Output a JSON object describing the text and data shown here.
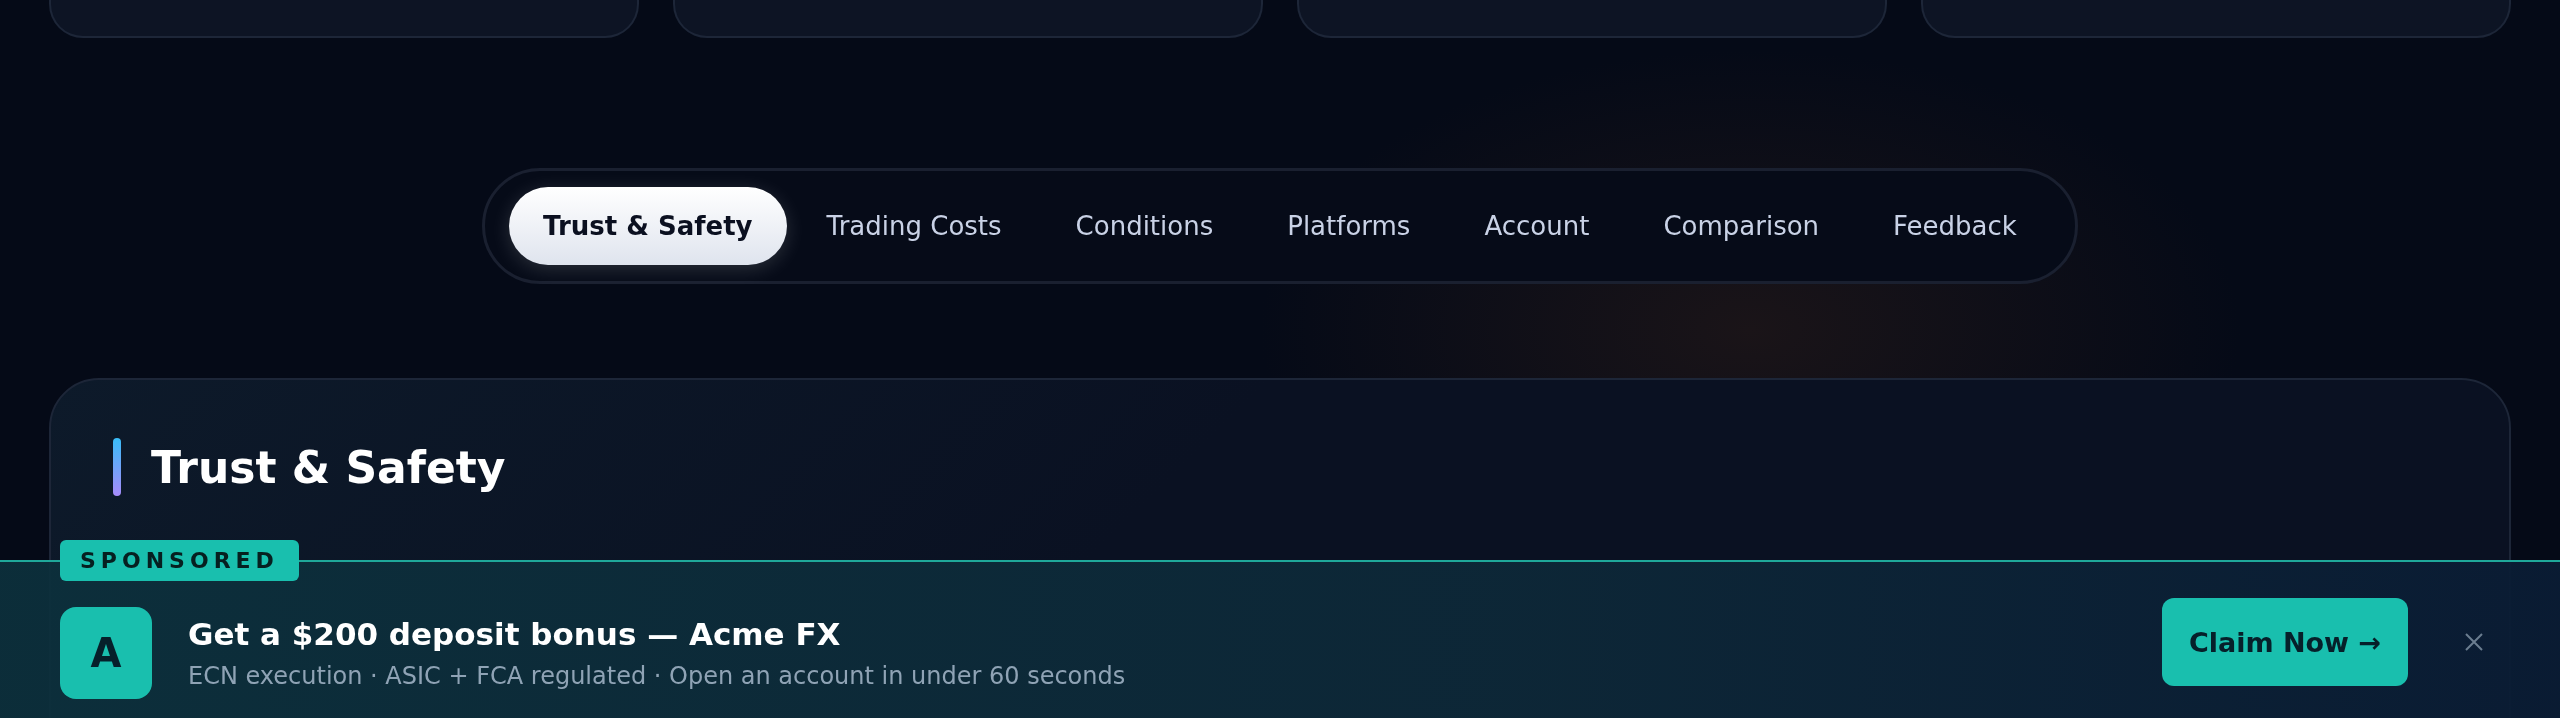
{
  "top_cards": [
    {
      "kind": "card"
    },
    {
      "kind": "card"
    },
    {
      "kind": "card"
    },
    {
      "kind": "card"
    }
  ],
  "tabs": [
    {
      "label": "Trust & Safety",
      "selected": true
    },
    {
      "label": "Trading Costs",
      "selected": false
    },
    {
      "label": "Conditions",
      "selected": false
    },
    {
      "label": "Platforms",
      "selected": false
    },
    {
      "label": "Account",
      "selected": false
    },
    {
      "label": "Comparison",
      "selected": false
    },
    {
      "label": "Feedback",
      "selected": false
    }
  ],
  "section": {
    "title": "Trust & Safety"
  },
  "ad_banner": {
    "badge": "SPONSORED",
    "logo_letter": "A",
    "title": "Get a $200 deposit bonus — Acme FX",
    "subtitle": "ECN execution · ASIC + FCA regulated · Open an account in under 60 seconds",
    "button": "Claim Now →"
  }
}
